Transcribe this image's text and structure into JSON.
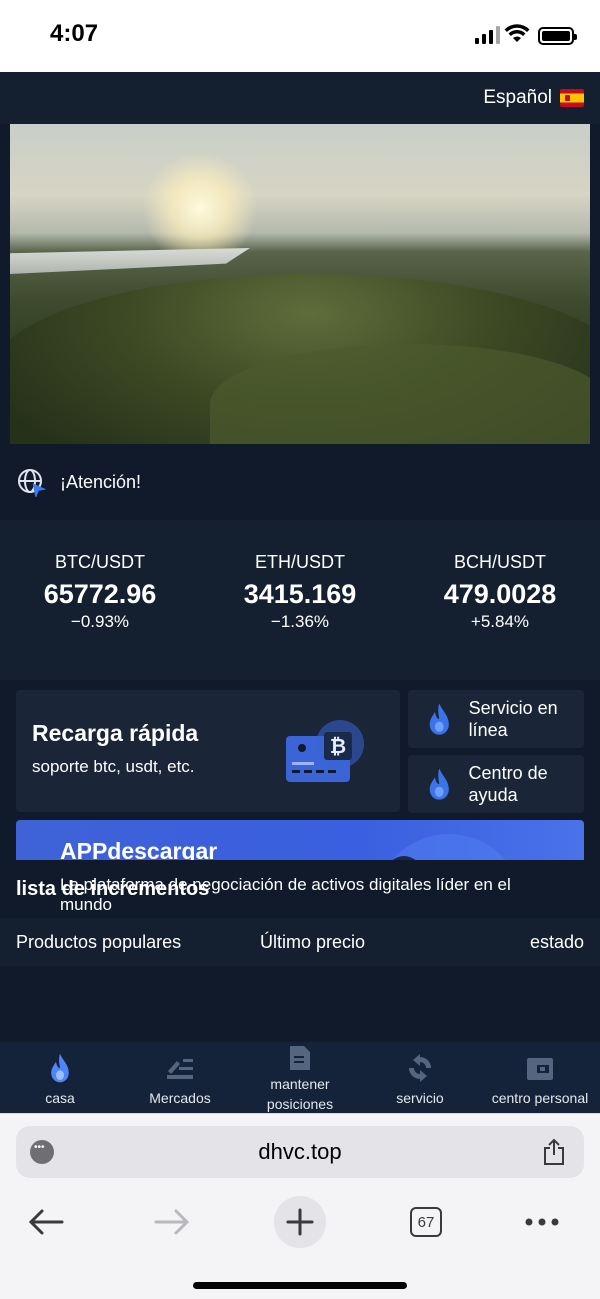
{
  "status_bar": {
    "time": "4:07"
  },
  "header": {
    "language": "Español"
  },
  "notice": {
    "text": "¡Atención!"
  },
  "tickers": [
    {
      "pair": "BTC/USDT",
      "price": "65772.96",
      "change": "−0.93%"
    },
    {
      "pair": "ETH/USDT",
      "price": "3415.169",
      "change": "−1.36%"
    },
    {
      "pair": "BCH/USDT",
      "price": "479.0028",
      "change": "+5.84%"
    }
  ],
  "recharge": {
    "title": "Recarga rápida",
    "subtitle": "soporte btc, usdt, etc."
  },
  "shortcuts": {
    "online_service": "Servicio en línea",
    "help_center": "Centro de ayuda"
  },
  "app_banner": {
    "title": "APPdescargar",
    "subtitle": "La plataforma de negociación de activos digitales líder en el mundo"
  },
  "increments": {
    "title": "lista de incrementos",
    "columns": [
      "Productos populares",
      "Último precio",
      "estado"
    ]
  },
  "tabbar": [
    {
      "label": "casa",
      "icon": "flame-icon"
    },
    {
      "label": "Mercados",
      "icon": "chart-icon"
    },
    {
      "label": "mantener posiciones",
      "icon": "document-icon"
    },
    {
      "label": "servicio",
      "icon": "refresh-icon"
    },
    {
      "label": "centro personal",
      "icon": "wallet-icon"
    }
  ],
  "browser": {
    "url": "dhvc.top",
    "tab_count": "67"
  },
  "colors": {
    "app_background": "#101a2a",
    "card_background": "#1a2638",
    "accent_blue": "#3a5fe0",
    "tab_active": "#4f86f7"
  }
}
